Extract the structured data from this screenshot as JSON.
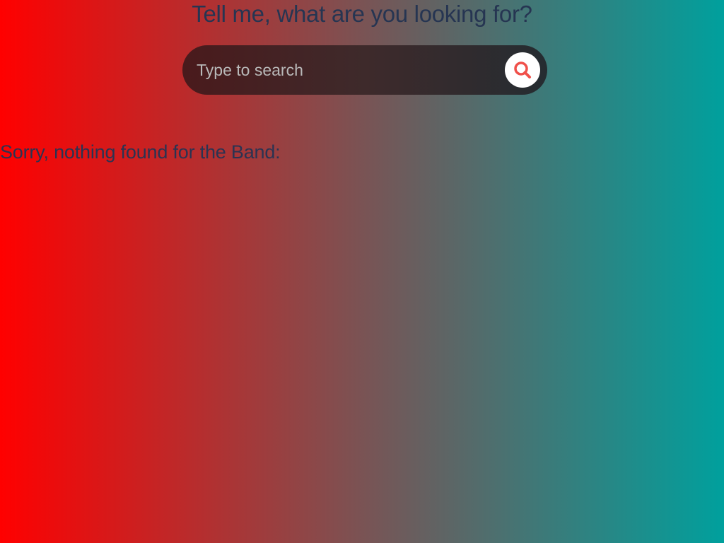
{
  "page": {
    "heading": "Tell me, what are you looking for?"
  },
  "search": {
    "placeholder": "Type to search",
    "value": "",
    "button_icon": "search-icon"
  },
  "results": {
    "message": "Sorry, nothing found for the Band:"
  },
  "colors": {
    "gradient_left": "#ff0000",
    "gradient_mid": "#7a5354",
    "gradient_right": "#00a09d",
    "text": "#263552",
    "search_bar_left": "#4a1a1c",
    "search_bar_right": "#252c31",
    "search_icon": "#f0504a"
  }
}
